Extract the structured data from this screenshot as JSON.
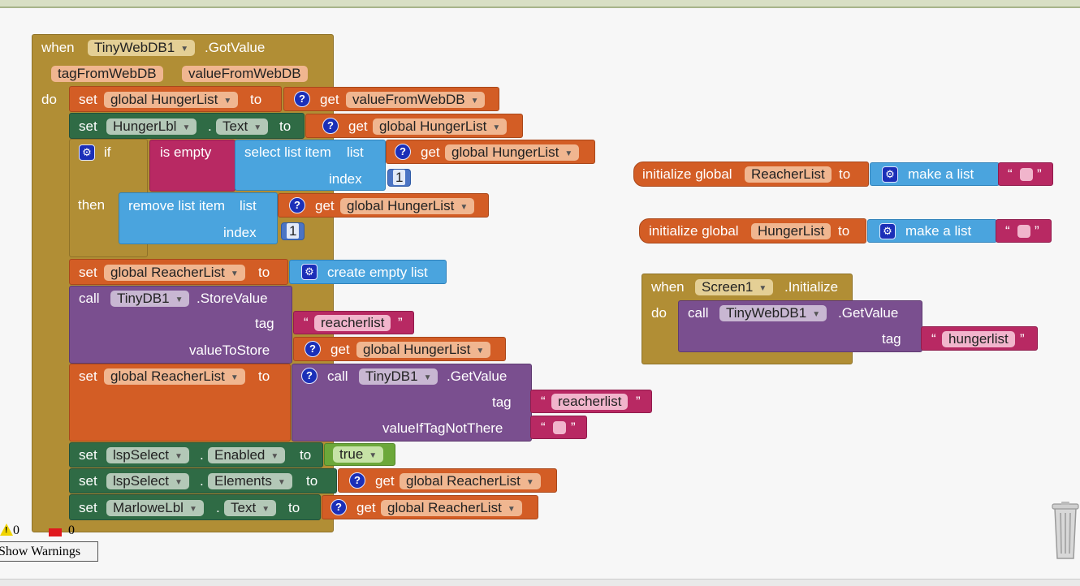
{
  "colors": {
    "event": "#b18e35",
    "orange": "#d35d25",
    "green": "#2f6b45",
    "blue": "#4aa4de",
    "purple": "#7a4f8f",
    "pink": "#b82963",
    "logic": "#6ca83a"
  },
  "blocks": {
    "kw": {
      "when": "when",
      "do": "do",
      "set": "set",
      "to": "to",
      "get": "get",
      "call": "call",
      "if": "if",
      "then": "then",
      "initialize_global": "initialize global",
      "dot": ".",
      "open_quote": "“",
      "close_quote": "”",
      "question": "?"
    },
    "gotvalue_event": {
      "component": "TinyWebDB1",
      "event": ".GotValue",
      "params": [
        "tagFromWebDB",
        "valueFromWebDB"
      ],
      "set1": {
        "var": "global HungerList",
        "get": "valueFromWebDB"
      },
      "set2": {
        "component": "HungerLbl",
        "prop": "Text",
        "get": "global HungerList"
      },
      "if_block": {
        "is_empty": "is empty",
        "select_list_item": "select list item",
        "list": "list",
        "get": "global HungerList",
        "index": "index",
        "index_value": "1"
      },
      "then_block": {
        "remove_list_item": "remove list item",
        "list": "list",
        "get": "global HungerList",
        "index": "index",
        "index_value": "1"
      },
      "set3": {
        "var": "global ReacherList",
        "value": "create empty list"
      },
      "store": {
        "component": "TinyDB1",
        "method": ".StoreValue",
        "tag": "tag",
        "tag_value": "reacherlist",
        "value_to_store": "valueToStore",
        "get": "global HungerList"
      },
      "set4": {
        "var": "global ReacherList",
        "component": "TinyDB1",
        "method": ".GetValue",
        "tag": "tag",
        "tag_value": "reacherlist",
        "default": "valueIfTagNotThere"
      },
      "set5": {
        "component": "lspSelect",
        "prop": "Enabled",
        "value": "true"
      },
      "set6": {
        "component": "lspSelect",
        "prop": "Elements",
        "get": "global ReacherList"
      },
      "set7": {
        "component": "MarloweLbl",
        "prop": "Text",
        "get": "global ReacherList"
      }
    },
    "init_reacher": {
      "name": "ReacherList",
      "make_list": "make a list"
    },
    "init_hunger": {
      "name": "HungerList",
      "make_list": "make a list"
    },
    "screen_init": {
      "component": "Screen1",
      "event": ".Initialize",
      "call_component": "TinyWebDB1",
      "call_method": ".GetValue",
      "tag": "tag",
      "tag_value": "hungerlist"
    }
  },
  "warnings": {
    "warning_count": "0",
    "error_count": "0",
    "show_label": "Show Warnings"
  },
  "icons": {
    "gear": "gear-icon",
    "help": "question-icon",
    "trash": "trash-icon",
    "warning": "warning-icon",
    "error": "error-icon"
  }
}
